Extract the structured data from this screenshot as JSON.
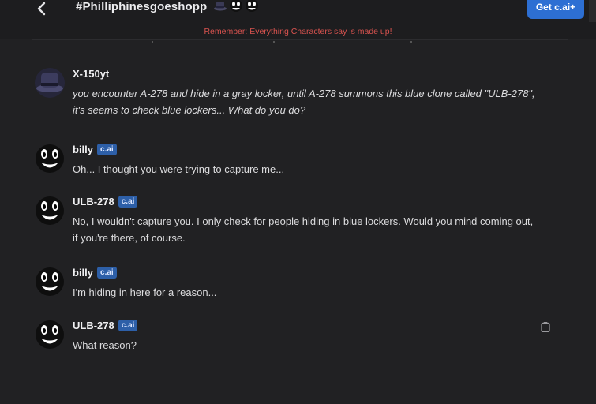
{
  "header": {
    "title": "#Philliphinesgoeshopp",
    "get_button": "Get c.ai+",
    "notice": "Remember: Everything Characters say is made up!",
    "emojis": [
      "spy-hat-icon",
      "smiley-face-icon",
      "smiley-face-icon"
    ]
  },
  "messages": [
    {
      "author": "X-150yt",
      "badge": "",
      "avatar": "hat-avatar",
      "text": "you encounter A-278 and hide in a gray locker, until A-278 summons this blue clone called \"ULB-278\", it's seems to check blue lockers... What do you do?"
    },
    {
      "author": "billy",
      "badge": "c.ai",
      "avatar": "smiley-avatar",
      "text": "Oh... I thought you were trying to capture me..."
    },
    {
      "author": "ULB-278",
      "badge": "c.ai",
      "avatar": "smiley-avatar",
      "text": "No, I wouldn't capture you. I only check for people hiding in blue lockers. Would you mind coming out, if you're there, of course."
    },
    {
      "author": "billy",
      "badge": "c.ai",
      "avatar": "smiley-avatar",
      "text": "I'm hiding in here for a reason..."
    },
    {
      "author": "ULB-278",
      "badge": "c.ai",
      "avatar": "smiley-avatar",
      "text": "What reason?"
    }
  ],
  "colors": {
    "background": "#212123",
    "accent": "#2d6fd3",
    "notice": "#d9534f",
    "badge": "#2d5fa8"
  }
}
